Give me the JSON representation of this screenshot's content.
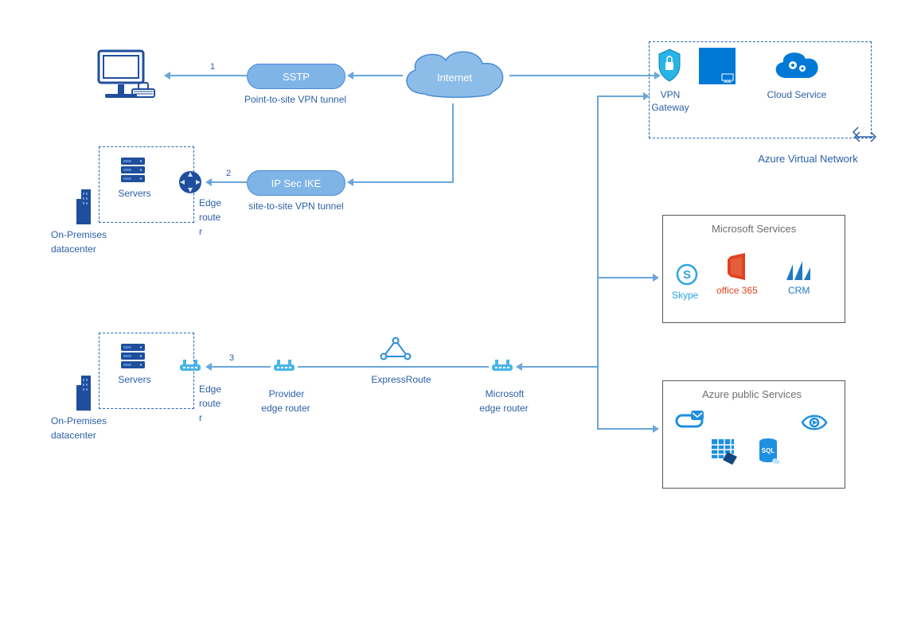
{
  "nodes": {
    "computer": {
      "label": ""
    },
    "sstp": {
      "label": "SSTP",
      "sub": "Point-to-site VPN tunnel",
      "num": "1"
    },
    "internet": {
      "label": "Internet"
    },
    "vpn_gateway": {
      "label": "VPN",
      "label2": "Gateway"
    },
    "vm": {
      "label": ""
    },
    "cloud_service": {
      "label": "Cloud Service"
    },
    "vnet": {
      "label": "Azure Virtual Network"
    },
    "onprem1": {
      "label": "On-Premises",
      "label2": "datacenter",
      "servers": "Servers",
      "edge": "Edge",
      "edge2": "route",
      "edge3": "r"
    },
    "ipsec": {
      "label": "IP Sec IKE",
      "sub": "site-to-site VPN tunnel",
      "num": "2"
    },
    "onprem2": {
      "label": "On-Premises",
      "label2": "datacenter",
      "servers": "Servers",
      "edge": "Edge",
      "edge2": "route",
      "edge3": "r"
    },
    "provider_router": {
      "label": "Provider",
      "label2": "edge router"
    },
    "expressroute": {
      "label": "ExpressRoute",
      "num": "3"
    },
    "ms_router": {
      "label": "Microsoft",
      "label2": "edge router"
    },
    "ms_services": {
      "title": "Microsoft Services",
      "skype": "Skype",
      "office": "office 365",
      "crm": "CRM"
    },
    "azure_public": {
      "title": "Azure public Services"
    }
  }
}
